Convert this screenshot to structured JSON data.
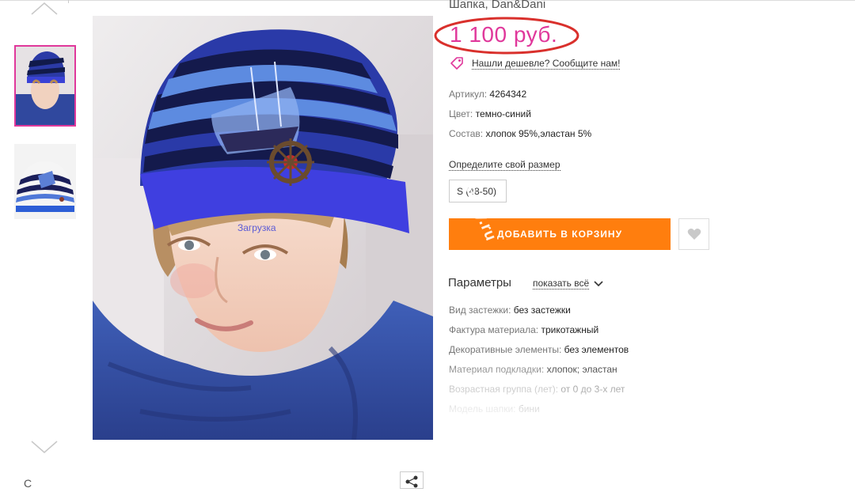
{
  "product": {
    "title": "Шапка, Dan&Dani",
    "price": "1 100 руб.",
    "cheaper_link": "Нашли дешевле? Сообщите нам!",
    "attributes": [
      {
        "key": "Артикул:",
        "value": "4264342"
      },
      {
        "key": "Цвет:",
        "value": "темно-синий"
      },
      {
        "key": "Состав:",
        "value": "хлопок 95%,эластан 5%"
      }
    ],
    "size_link": "Определите свой размер",
    "size_option": "S (48-50)",
    "add_to_cart": "ДОБАВИТЬ В КОРЗИНУ",
    "params_title": "Параметры",
    "show_all": "показать всё",
    "params": [
      {
        "key": "Вид застежки:",
        "value": "без застежки"
      },
      {
        "key": "Фактура материала:",
        "value": "трикотажный"
      },
      {
        "key": "Декоративные элементы:",
        "value": "без элементов"
      },
      {
        "key": "Материал подкладки:",
        "value": "хлопок; эластан"
      },
      {
        "key": "Возрастная группа (лет):",
        "value": "от 0 до 3-х лет"
      },
      {
        "key": "Модель шапки:",
        "value": "бини"
      }
    ]
  },
  "gallery": {
    "loading_text": "Загрузка",
    "bottom_letter": "С"
  },
  "watermark": "aroy.ru",
  "colors": {
    "accent_pink": "#e0389b",
    "button_orange": "#ff7e0e",
    "annotation_red": "#d9302c"
  }
}
